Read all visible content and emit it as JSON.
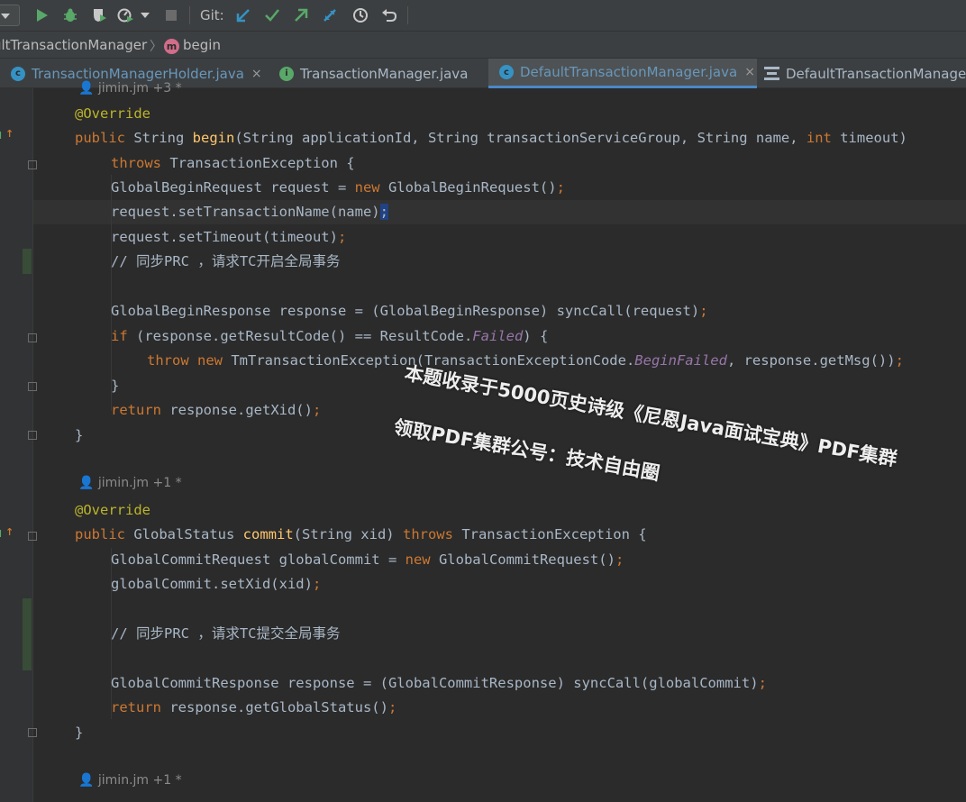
{
  "toolbar": {
    "git_label": "Git:",
    "icons": [
      "run-icon",
      "debug-icon",
      "coverage-icon",
      "profile-icon",
      "more-dropdown-icon",
      "stop-icon",
      "git-update-icon",
      "git-commit-icon",
      "git-push-icon",
      "git-merge-icon",
      "history-icon",
      "rollback-icon"
    ]
  },
  "breadcrumb": {
    "class_name": "ultTransactionManager",
    "method_badge": "m",
    "method_name": "begin"
  },
  "tabs": [
    {
      "label": "TransactionManagerHolder.java",
      "icon": "c",
      "close": "×"
    },
    {
      "label": "TransactionManager.java",
      "icon": "i",
      "close": ""
    },
    {
      "label": "DefaultTransactionManager.java",
      "icon": "c",
      "close": "×"
    },
    {
      "label": "DefaultTransactionManager",
      "icon": "structure",
      "close": ""
    }
  ],
  "code": {
    "author1": "jimin.jm +3 *",
    "override1": "@Override",
    "l1_kw": "public",
    "l1_type": " String ",
    "l1_fn": "begin",
    "l1_params_a": "(String applicationId, String transactionServiceGroup, String name, ",
    "l1_int": "int",
    "l1_params_b": " timeout)",
    "l2_kw": "throws",
    "l2_rest": " TransactionException {",
    "l3_a": "GlobalBeginRequest request = ",
    "l3_new": "new",
    "l3_b": " GlobalBeginRequest()",
    "l3_semi": ";",
    "l4_a": "request.setTransactionName(name)",
    "l4_semi": ";",
    "l5_a": "request.setTimeout(timeout)",
    "l5_semi": ";",
    "l6_comment": "// 同步PRC ，请求TC开启全局事务",
    "l7_a": "GlobalBeginResponse response = (GlobalBeginResponse) syncCall(request)",
    "l7_semi": ";",
    "l8_if": "if",
    "l8_a": " (response.getResultCode() == ResultCode.",
    "l8_failed": "Failed",
    "l8_b": ") {",
    "l9_throw": "throw",
    "l9_new": "new",
    "l9_a": " TmTransactionException(TransactionExceptionCode.",
    "l9_bf": "BeginFailed",
    "l9_b": ", response.getMsg())",
    "l9_semi": ";",
    "l10": "}",
    "l11_ret": "return",
    "l11_a": " response.getXid()",
    "l11_semi": ";",
    "l12": "}",
    "author2": "jimin.jm +1 *",
    "override2": "@Override",
    "l13_kw": "public",
    "l13_type": " GlobalStatus ",
    "l13_fn": "commit",
    "l13_a": "(String xid) ",
    "l13_throws": "throws",
    "l13_b": " TransactionException {",
    "l14_a": "GlobalCommitRequest globalCommit = ",
    "l14_new": "new",
    "l14_b": " GlobalCommitRequest()",
    "l14_semi": ";",
    "l15_a": "globalCommit.setXid(xid)",
    "l15_semi": ";",
    "l16_comment": "// 同步PRC ，请求TC提交全局事务",
    "l17_a": "GlobalCommitResponse response = (GlobalCommitResponse) syncCall(globalCommit)",
    "l17_semi": ";",
    "l18_ret": "return",
    "l18_a": " response.getGlobalStatus()",
    "l18_semi": ";",
    "l19": "}",
    "author3": "jimin.jm +1 *"
  },
  "watermark": {
    "line1": "本题收录于5000页史诗级《尼恩Java面试宝典》PDF集群",
    "line2": "领取PDF集群公号：技术自由圈"
  },
  "colors": {
    "keyword": "#cc7832",
    "annotation": "#bbb529",
    "function": "#ffc66d",
    "constant": "#9876aa",
    "text": "#a9b7c6",
    "background": "#2b2b2b"
  }
}
